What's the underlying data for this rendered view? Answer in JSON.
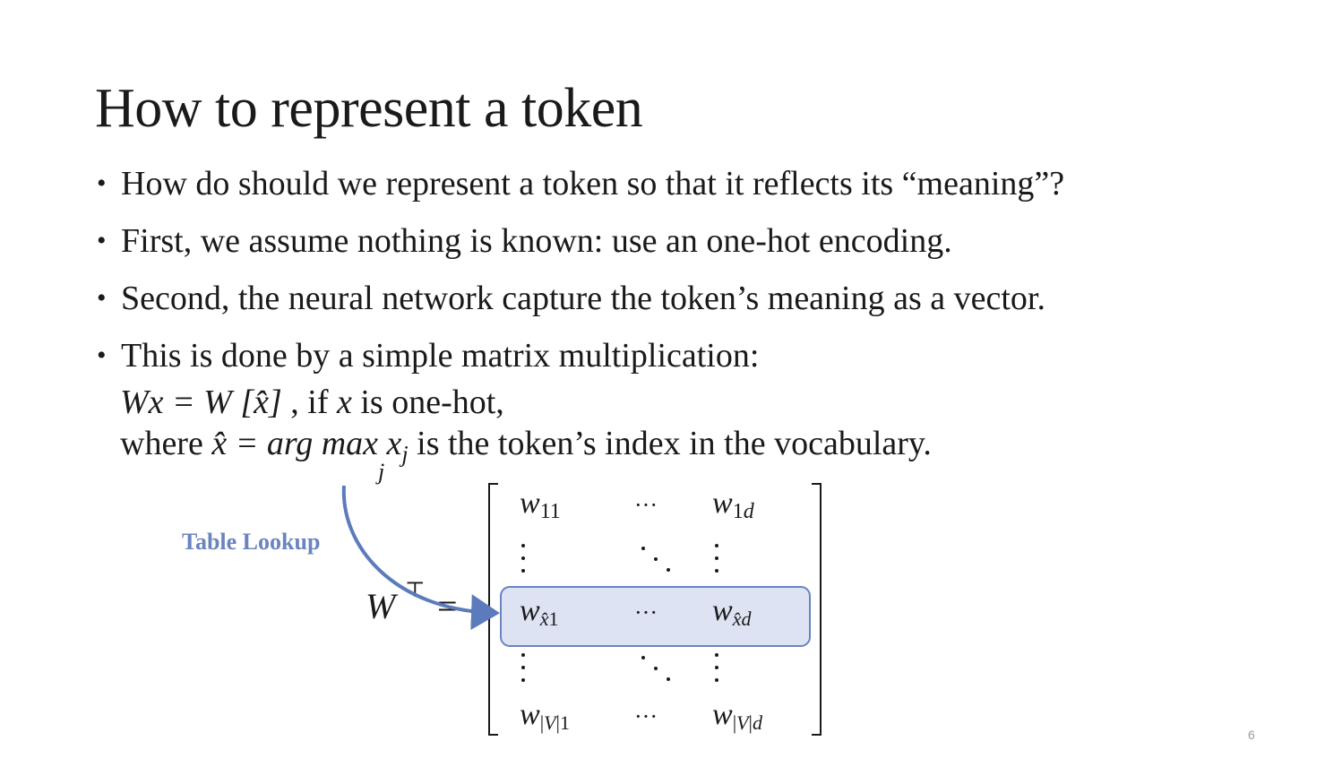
{
  "slide": {
    "title": "How to represent a token",
    "bullets": [
      "How do should we represent a token so that it reflects its “meaning”?",
      "First, we assume nothing is known: use an one-hot encoding.",
      "Second, the neural network capture the token’s meaning as a vector.",
      "This is done by a simple matrix multiplication:"
    ],
    "equation_line": {
      "lhs": "Wx = W [x̂]",
      "mid": " , if ",
      "var": "x",
      "tail": " is one-hot,"
    },
    "where_line": {
      "lead": "where ",
      "expr": "x̂ = arg max x",
      "sub": "j",
      "tail": " is the token’s index in the vocabulary.",
      "under": "j"
    },
    "lookup_label": "Table Lookup",
    "matrix": {
      "lhs": "W",
      "lhs_sup": "⊤",
      "equals": "=",
      "row1": [
        "w11",
        "···",
        "w1d"
      ],
      "row_hat": [
        "wx̂1",
        "···",
        "wx̂d"
      ],
      "row_last": [
        "w|V|1",
        "···",
        "w|V|d"
      ]
    },
    "colors": {
      "accent": "#5b7bbd",
      "highlight_fill": "#dde3f3",
      "highlight_stroke": "#6a84c0",
      "label": "#6a84c0"
    },
    "page_number": "6"
  }
}
